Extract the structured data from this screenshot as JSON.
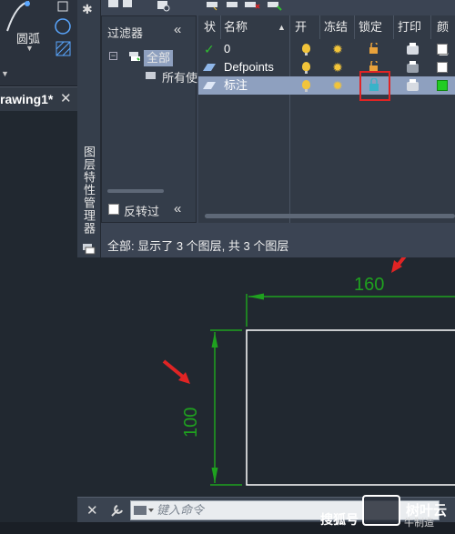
{
  "ribbon": {
    "arc_label": "圆弧"
  },
  "drawing_tab": {
    "label": "rawing1*"
  },
  "palette": {
    "vertical_title": "图层特性管理器",
    "filter_header": "过滤器",
    "tree_root": "全部",
    "tree_child": "所有使",
    "invert_label": "反转过",
    "status": "全部: 显示了 3 个图层, 共 3 个图层"
  },
  "columns": [
    "状",
    "名称",
    "开",
    "冻结",
    "锁定",
    "打印",
    "颜色"
  ],
  "layers": [
    {
      "name": "0",
      "status": "current",
      "color": "#ffffff",
      "locked": false
    },
    {
      "name": "Defpoints",
      "status": "layer",
      "color": "#ffffff",
      "locked": false
    },
    {
      "name": "标注",
      "status": "layer",
      "color": "#22cc22",
      "locked": true
    }
  ],
  "drawing": {
    "horizontal_dim": "160",
    "vertical_dim": "100"
  },
  "command": {
    "placeholder": "键入命令"
  },
  "watermark": {
    "left": "搜狐号",
    "right": "树叶云",
    "sub": "牛制造"
  },
  "colors": {
    "dimension": "#1fa11f",
    "annotation_arrow": "#e02424",
    "highlight_box": "#e02424"
  }
}
